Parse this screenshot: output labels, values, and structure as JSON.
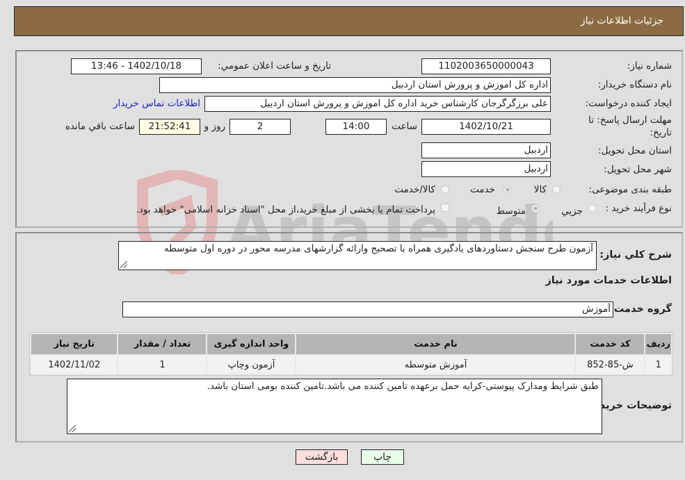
{
  "header": {
    "title": "جزئیات اطلاعات نیاز"
  },
  "details": {
    "need_number_label": "شماره نیاز:",
    "need_number": "1102003650000043",
    "announce_label": "تاریخ و ساعت اعلان عمومي:",
    "announce_value": "1402/10/18 - 13:46",
    "buyer_org_label": "نام دستگاه خریدار:",
    "buyer_org": "اداره کل اموزش و پرورش استان اردبیل",
    "requester_label": "ایجاد کننده درخواست:",
    "requester": "علی برزگرگرجان کارشناس خرید اداره کل اموزش و پرورش استان اردبیل",
    "buyer_contact_link": "اطلاعات تماس خریدار",
    "deadline_label": "مهلت ارسال پاسخ: تا تاریخ:",
    "deadline_date": "1402/10/21",
    "time_label": "ساعت",
    "deadline_time": "14:00",
    "days_value": "2",
    "days_label": "روز و",
    "remaining_time": "21:52:41",
    "remaining_label": "ساعت باقي مانده",
    "province_label": "استان محل تحویل:",
    "province": "اردبیل",
    "city_label": "شهر محل تحویل:",
    "city": "اردبیل",
    "category_label": "طبقه بندی موضوعی:",
    "category_options": [
      {
        "label": "کالا",
        "selected": false
      },
      {
        "label": "خدمت",
        "selected": true
      },
      {
        "label": "کالا/خدمت",
        "selected": false
      }
    ],
    "process_label": "نوع فرآیند خرید :",
    "process_options": [
      {
        "label": "جزيي",
        "selected": false
      },
      {
        "label": "متوسط",
        "selected": true
      }
    ],
    "treasury_checkbox_label": "پرداخت تمام یا بخشی از مبلغ خرید،از محل \"اسناد خزانه اسلامی\" خواهد بود.",
    "treasury_checked": false
  },
  "services": {
    "description_label": "شرح کلي نیاز:",
    "description": "آزمون طرح سنجش دستاوردهای یادگیری همراه با تصحیح وارائه گزارشهای مدرسه محور در دوره اول متوسطه",
    "section_title": "اطلاعات خدمات مورد نیاز",
    "service_group_label": "گروه خدمت:",
    "service_group": "آموزش",
    "table": {
      "headers": [
        "ردیف",
        "کد خدمت",
        "نام خدمت",
        "واحد اندازه گیری",
        "تعداد / مقدار",
        "تاریخ نیاز"
      ],
      "rows": [
        [
          "1",
          "ش-85-852",
          "آموزش متوسطه",
          "آزمون وچاپ",
          "1",
          "1402/11/02"
        ]
      ]
    },
    "buyer_notes_label": "توضیحات خریدار:",
    "buyer_notes": "طبق شرایط ومدارک پیوستی-کرایه حمل برعهده تامین کننده می باشد.تامین کننده بومی استان باشد."
  },
  "buttons": {
    "print": "چاپ",
    "back": "بازگشت"
  },
  "colors": {
    "header_bg": "#8b6c42",
    "print_bg": "#eaffea",
    "back_bg": "#ffdede",
    "link": "#2020c8"
  },
  "watermark": {
    "text": "AriaTender.neT"
  }
}
